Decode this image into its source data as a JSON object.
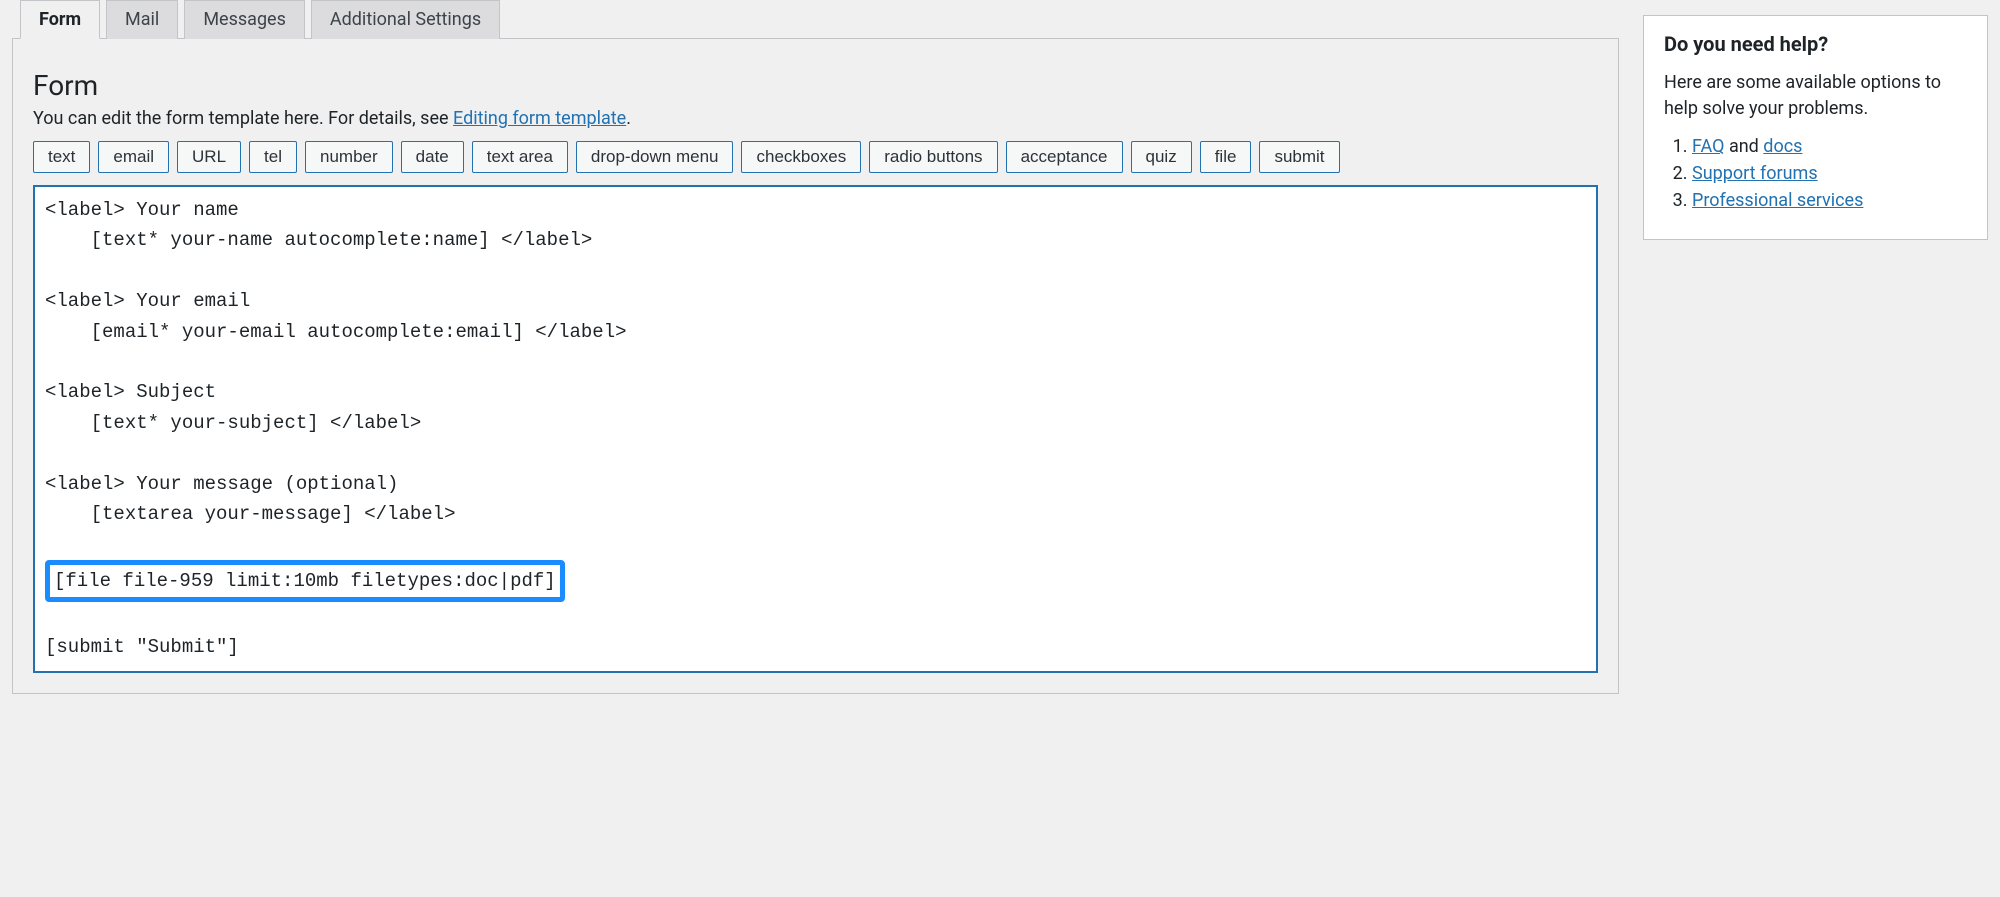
{
  "tabs": [
    {
      "label": "Form",
      "active": true
    },
    {
      "label": "Mail",
      "active": false
    },
    {
      "label": "Messages",
      "active": false
    },
    {
      "label": "Additional Settings",
      "active": false
    }
  ],
  "panel_title": "Form",
  "panel_desc_prefix": "You can edit the form template here. For details, see ",
  "panel_desc_link": "Editing form template",
  "panel_desc_suffix": ".",
  "tag_buttons": [
    "text",
    "email",
    "URL",
    "tel",
    "number",
    "date",
    "text area",
    "drop-down menu",
    "checkboxes",
    "radio buttons",
    "acceptance",
    "quiz",
    "file",
    "submit"
  ],
  "editor_lines": [
    {
      "t": "<label> Your name"
    },
    {
      "t": "    [text* your-name autocomplete:name] </label>"
    },
    {
      "t": ""
    },
    {
      "t": "<label> Your email"
    },
    {
      "t": "    [email* your-email autocomplete:email] </label>"
    },
    {
      "t": ""
    },
    {
      "t": "<label> Subject"
    },
    {
      "t": "    [text* your-subject] </label>"
    },
    {
      "t": ""
    },
    {
      "t": "<label> Your message (optional)"
    },
    {
      "t": "    [textarea your-message] </label>"
    },
    {
      "t": ""
    },
    {
      "t": "[file file-959 limit:10mb filetypes:doc|pdf]",
      "hl": true
    },
    {
      "t": ""
    },
    {
      "t": "[submit \"Submit\"]"
    }
  ],
  "help": {
    "title": "Do you need help?",
    "intro": "Here are some available options to help solve your problems.",
    "faq": "FAQ",
    "and": " and ",
    "docs": "docs",
    "sf": "Support forums",
    "ps": "Professional services"
  }
}
